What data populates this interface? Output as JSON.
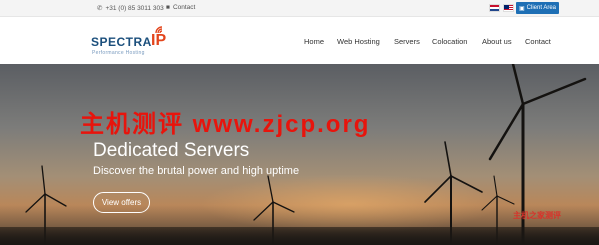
{
  "topbar": {
    "phone": "+31 (0) 85 3011 303",
    "contact": "Contact",
    "client_area": "Client Area"
  },
  "logo": {
    "word": "SPECTRA",
    "ip": "IP",
    "tagline": "Performance Hosting"
  },
  "nav": {
    "items": [
      "Home",
      "Web Hosting",
      "Servers",
      "Colocation",
      "About us",
      "Contact"
    ]
  },
  "hero": {
    "title": "Dedicated Servers",
    "subtitle": "Discover the brutal power and high uptime",
    "cta": "View offers"
  },
  "watermark": {
    "text": "主机测评  www.zjcp.org",
    "small": "主机之家测评"
  },
  "colors": {
    "brand_blue": "#1b4f7c",
    "brand_orange": "#e3451c",
    "client_button": "#1e6fb5"
  }
}
